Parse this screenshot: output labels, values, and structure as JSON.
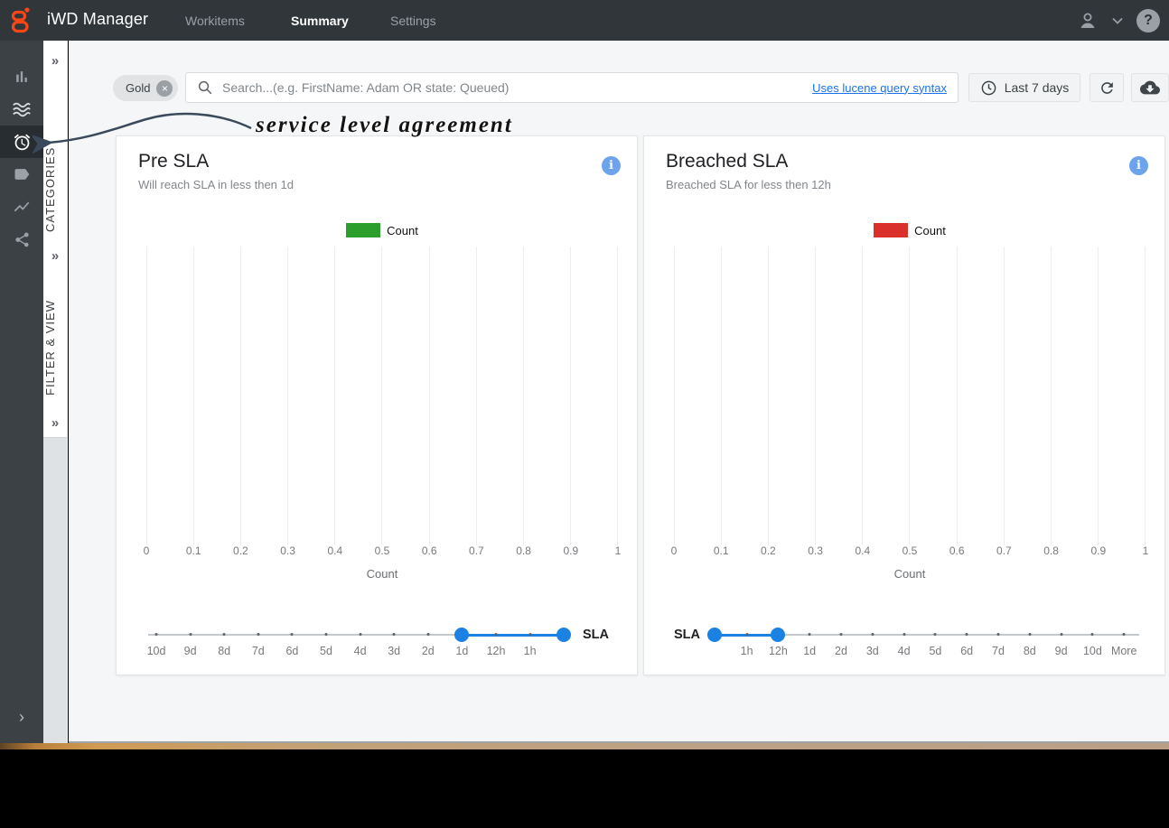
{
  "topbar": {
    "app_title": "iWD Manager",
    "tabs": [
      {
        "label": "Workitems"
      },
      {
        "label": "Summary"
      },
      {
        "label": "Settings"
      }
    ],
    "active_tab": "Summary",
    "help_glyph": "?",
    "user_chevron": "⌄"
  },
  "sidebar": {
    "icons": [
      "bar-chart",
      "waves",
      "alarm-clock",
      "tag",
      "trend-line",
      "share"
    ],
    "active_icon": "alarm-clock",
    "expand_chevron": "›"
  },
  "side_panel": {
    "collapse_chevron": "»",
    "sections": [
      {
        "label": "CATEGORIES"
      },
      {
        "label": "FILTER & VIEW"
      }
    ]
  },
  "toolbar": {
    "chip": "Gold",
    "chip_remove": "×",
    "search_placeholder": "Search...(e.g. FirstName: Adam OR state: Queued)",
    "syntax_link": "Uses lucene query syntax",
    "time_range": "Last 7 days"
  },
  "annotation": {
    "text": "service level agreement",
    "points_to": "alarm-clock-icon",
    "arrow_color": "#3a4a5c"
  },
  "cards": [
    {
      "title": "Pre SLA",
      "subtitle": "Will reach SLA in less then 1d",
      "info_glyph": "i",
      "chart_data": {
        "type": "bar",
        "series": [
          {
            "name": "Count",
            "color": "#2b9e2b",
            "values": []
          }
        ],
        "x_ticks": [
          "0",
          "0.1",
          "0.2",
          "0.3",
          "0.4",
          "0.5",
          "0.6",
          "0.7",
          "0.8",
          "0.9",
          "1"
        ],
        "x_range": [
          0,
          1
        ],
        "xlabel": "Count",
        "grid": "vertical-only",
        "legend_position": "top-center"
      },
      "slider": {
        "labels": [
          "10d",
          "9d",
          "8d",
          "7d",
          "6d",
          "5d",
          "4d",
          "3d",
          "2d",
          "1d",
          "12h",
          "1h"
        ],
        "selected_range": [
          "1d",
          "now"
        ],
        "side_label": "SLA",
        "side_label_position": "right",
        "accent_color": "#1a82e2"
      }
    },
    {
      "title": "Breached SLA",
      "subtitle": "Breached SLA for less then 12h",
      "info_glyph": "i",
      "chart_data": {
        "type": "bar",
        "series": [
          {
            "name": "Count",
            "color": "#d9302c",
            "values": []
          }
        ],
        "x_ticks": [
          "0",
          "0.1",
          "0.2",
          "0.3",
          "0.4",
          "0.5",
          "0.6",
          "0.7",
          "0.8",
          "0.9",
          "1"
        ],
        "x_range": [
          0,
          1
        ],
        "xlabel": "Count",
        "grid": "vertical-only",
        "legend_position": "top-center"
      },
      "slider": {
        "labels": [
          "1h",
          "12h",
          "1d",
          "2d",
          "3d",
          "4d",
          "5d",
          "6d",
          "7d",
          "8d",
          "9d",
          "10d",
          "More"
        ],
        "selected_range": [
          "start",
          "12h"
        ],
        "side_label": "SLA",
        "side_label_position": "left",
        "accent_color": "#1a82e2"
      }
    }
  ],
  "colors": {
    "topbar_bg": "#31363a",
    "rail_bg": "#3c4145",
    "rail_active_bg": "#282d31",
    "brand_orange": "#fa4616",
    "link_blue": "#1a73e8",
    "info_blue": "#6da3ea",
    "slider_blue": "#1a82e2",
    "legend_green": "#2b9e2b",
    "legend_red": "#d9302c"
  }
}
